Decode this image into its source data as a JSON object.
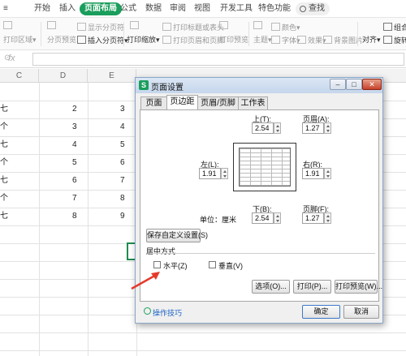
{
  "ribbon": {
    "tabs": [
      "开始",
      "插入",
      "页面布局",
      "公式",
      "数据",
      "审阅",
      "视图",
      "开发工具",
      "特色功能"
    ],
    "active_tab": "页面布局",
    "search_label": "查找",
    "tools": {
      "print_area": "打印区域",
      "page_preview": "分页预览",
      "show_page_break": "显示分页符",
      "insert_page_break": "插入分页符",
      "print_zoom": "打印缩放",
      "print_titles": "打印标题或表头",
      "print_header_footer": "打印页眉和页脚",
      "print_preview": "打印预览",
      "theme": "主题",
      "color": "颜色",
      "font": "字体",
      "effect": "效果",
      "background": "背景图片",
      "align": "对齐",
      "combine": "组合",
      "rotate": "旋转"
    }
  },
  "formula_bar": {
    "fx": "fx",
    "value": ""
  },
  "grid": {
    "columns": [
      "C",
      "D",
      "E"
    ],
    "rows": [
      {
        "c": "七",
        "d": "2",
        "e": "3"
      },
      {
        "c": "个",
        "d": "3",
        "e": "4"
      },
      {
        "c": "七",
        "d": "4",
        "e": "5"
      },
      {
        "c": "个",
        "d": "5",
        "e": "6"
      },
      {
        "c": "七",
        "d": "6",
        "e": "7"
      },
      {
        "c": "个",
        "d": "7",
        "e": "8"
      },
      {
        "c": "七",
        "d": "8",
        "e": "9"
      }
    ]
  },
  "dialog": {
    "title": "页面设置",
    "icon_letter": "S",
    "tabs": [
      "页面",
      "页边距",
      "页眉/页脚",
      "工作表"
    ],
    "active_tab": "页边距",
    "margins": {
      "top": {
        "label": "上(T):",
        "value": "2.54"
      },
      "header": {
        "label": "页眉(A):",
        "value": "1.27"
      },
      "left": {
        "label": "左(L):",
        "value": "1.91"
      },
      "right": {
        "label": "右(R):",
        "value": "1.91"
      },
      "bottom": {
        "label": "下(B):",
        "value": "2.54"
      },
      "footer": {
        "label": "页脚(F):",
        "value": "1.27"
      },
      "unit": "单位：厘米"
    },
    "save_custom": "保存自定义设置(S)",
    "center_section": "居中方式",
    "horizontal": {
      "label": "水平(Z)",
      "checked": false
    },
    "vertical": {
      "label": "垂直(V)",
      "checked": false
    },
    "buttons": {
      "options": "选项(O)...",
      "print": "打印(P)...",
      "print_preview": "打印预览(W)..."
    },
    "tips": "操作技巧",
    "ok": "确定",
    "cancel": "取消"
  },
  "colors": {
    "accent": "#1a9e5c",
    "arrow": "#e53a2b"
  }
}
